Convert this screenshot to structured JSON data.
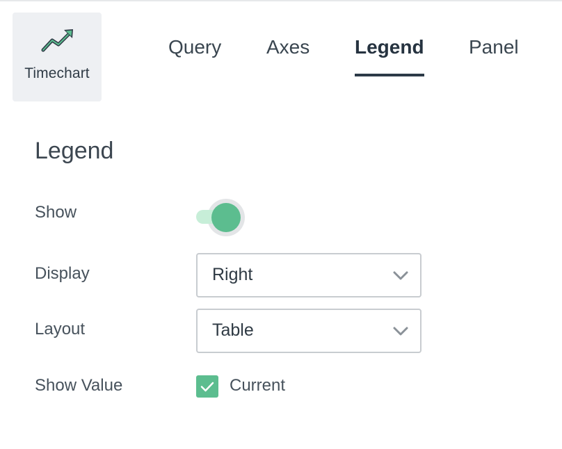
{
  "visualization": {
    "label": "Timechart",
    "icon": "trend-up-icon"
  },
  "tabs": [
    {
      "label": "Query",
      "active": false
    },
    {
      "label": "Axes",
      "active": false
    },
    {
      "label": "Legend",
      "active": true
    },
    {
      "label": "Panel",
      "active": false
    }
  ],
  "legend": {
    "title": "Legend",
    "show": {
      "label": "Show",
      "value": true
    },
    "display": {
      "label": "Display",
      "value": "Right"
    },
    "layout": {
      "label": "Layout",
      "value": "Table"
    },
    "show_value": {
      "label": "Show Value",
      "option": "Current",
      "checked": true
    }
  },
  "colors": {
    "accent": "#5cbd8f",
    "accent_light": "#c7eed8",
    "tab_active": "#2c3a47",
    "card_bg": "#eef0f3"
  }
}
